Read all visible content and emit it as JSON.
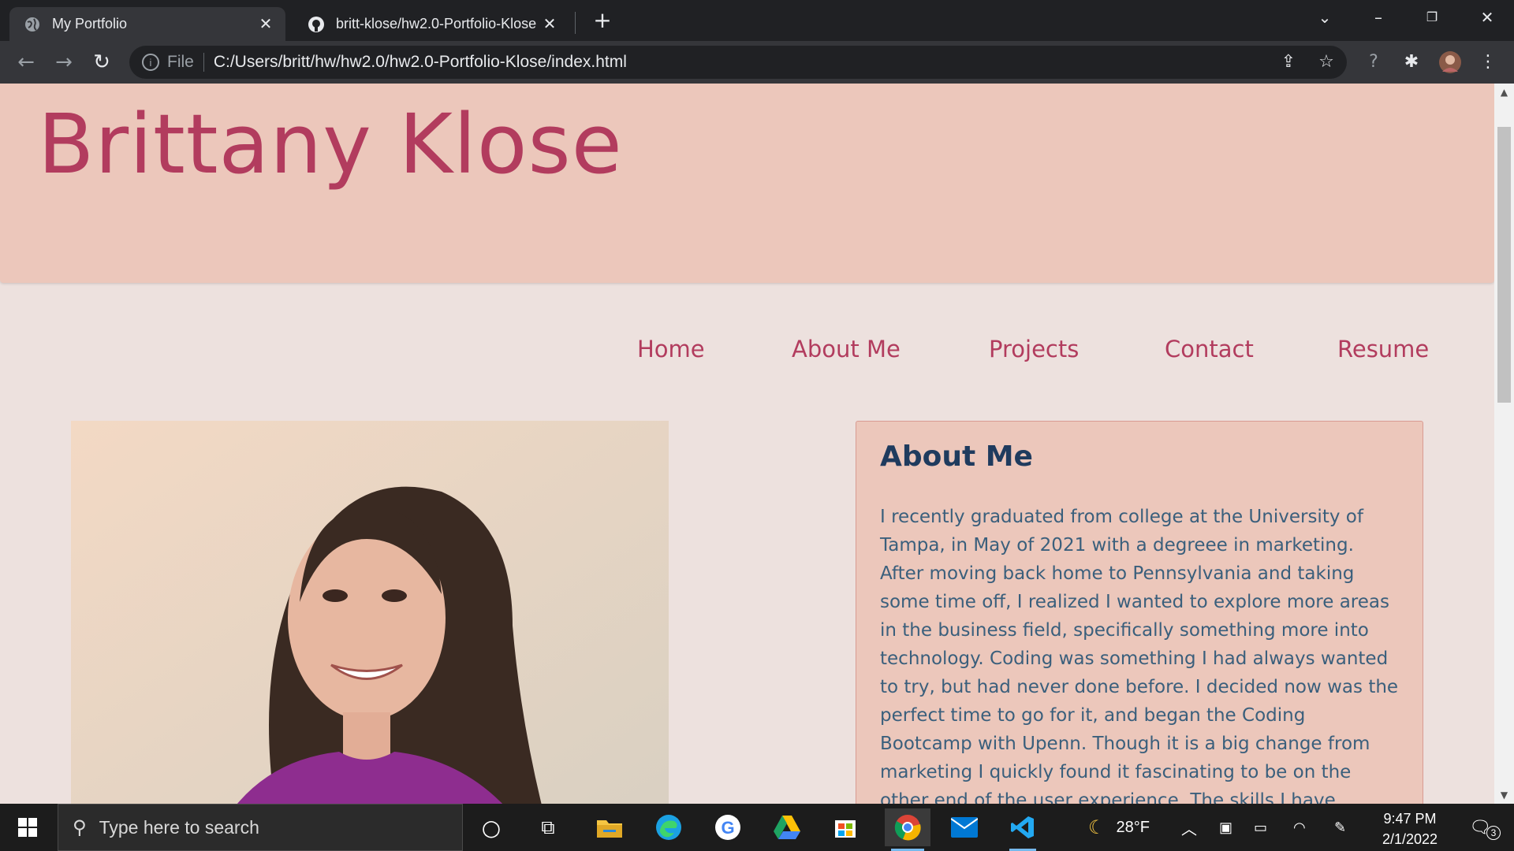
{
  "browser": {
    "tabs": [
      {
        "title": "My Portfolio",
        "icon": "globe-icon",
        "active": true
      },
      {
        "title": "britt-klose/hw2.0-Portfolio-Klose",
        "icon": "github-icon",
        "active": false
      }
    ],
    "new_tab": "+",
    "address": {
      "scheme": "File",
      "url": "C:/Users/britt/hw/hw2.0/hw2.0-Portfolio-Klose/index.html"
    }
  },
  "page": {
    "site_title": "Brittany Klose",
    "nav": [
      "Home",
      "About Me",
      "Projects",
      "Contact",
      "Resume"
    ],
    "about": {
      "heading": "About Me",
      "body": "I recently graduated from college at the University of Tampa, in May of 2021 with a degreee in marketing. After moving back home to Pennsylvania and taking some time off, I realized I wanted to explore more areas in the business field, specifically something more into technology. Coding was something I had always wanted to try, but had never done before. I decided now was the perfect time to go for it, and began the Coding Bootcamp with Upenn. Though it is a big change from marketing I quickly found it fascinating to be on the other end of the user experience. The skills I have learned"
    }
  },
  "taskbar": {
    "search_placeholder": "Type here to search",
    "weather": "28°F",
    "time": "9:47 PM",
    "date": "2/1/2022",
    "notifications": "3"
  },
  "colors": {
    "accent": "#b23c5e",
    "header_bg": "#ecc7bb",
    "page_bg": "#ede1de",
    "heading": "#1f3b5e"
  }
}
